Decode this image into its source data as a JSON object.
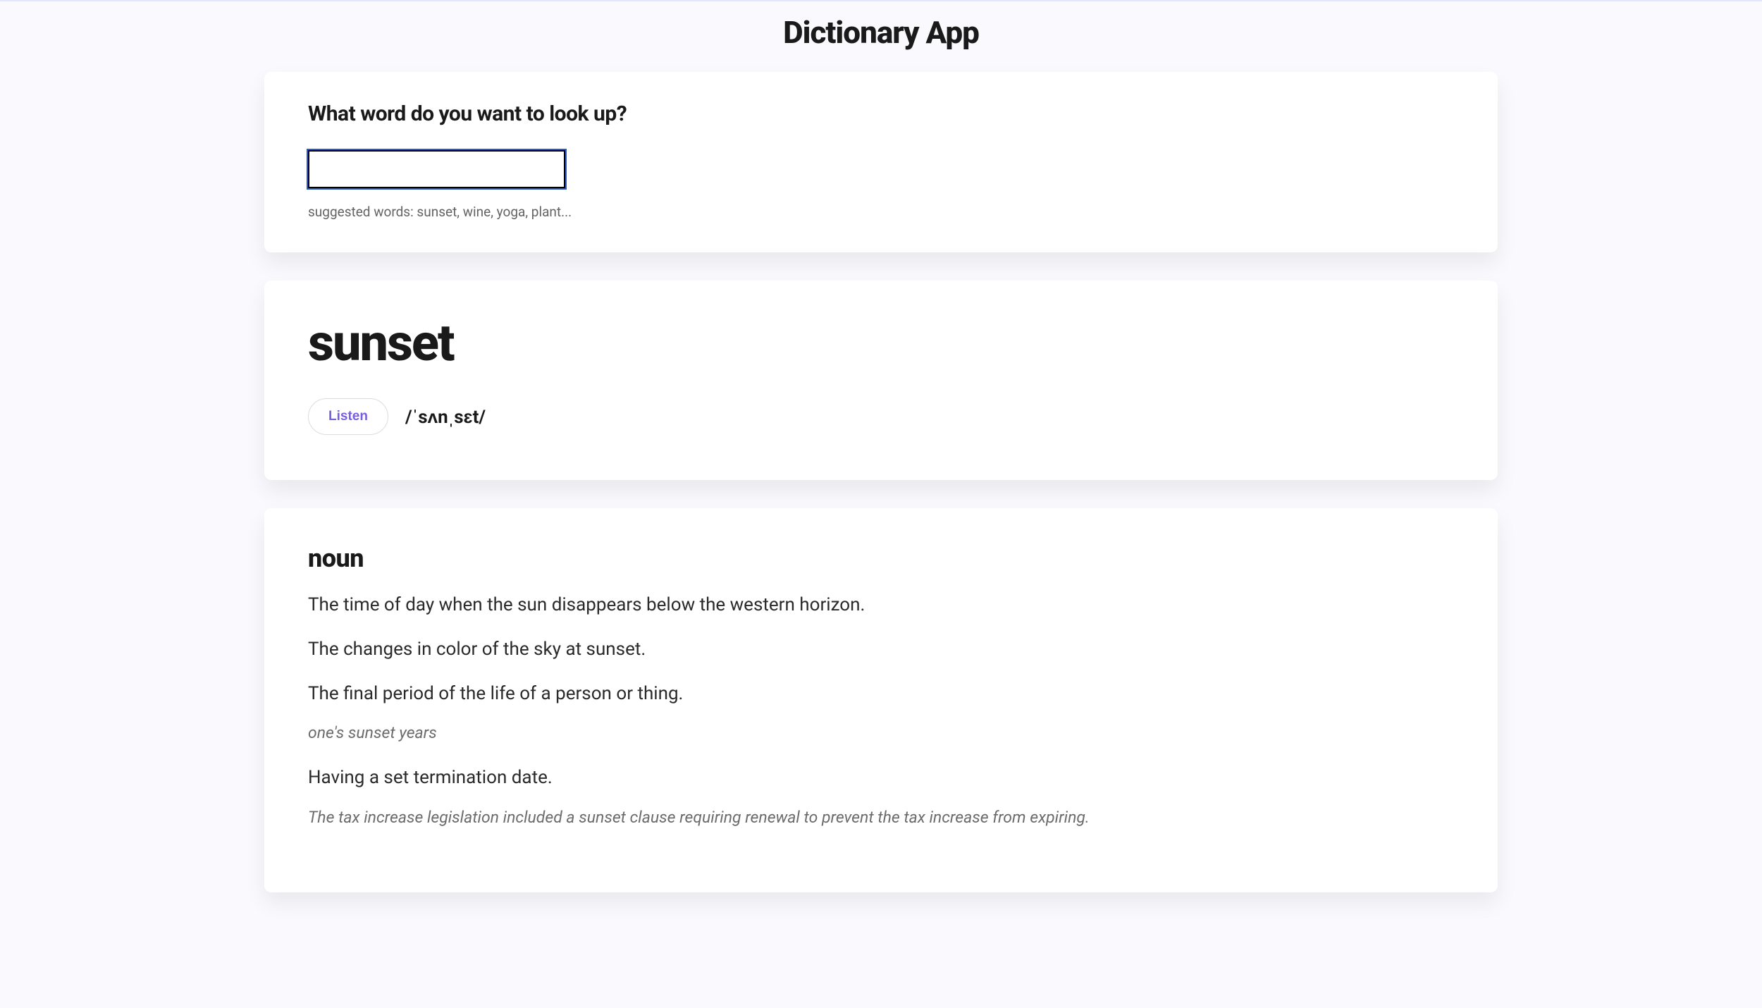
{
  "app": {
    "title": "Dictionary App"
  },
  "search": {
    "prompt": "What word do you want to look up?",
    "value": "",
    "placeholder": "",
    "suggested_line": "suggested words: sunset, wine, yoga, plant..."
  },
  "entry": {
    "word": "sunset",
    "listen_label": "Listen",
    "phonetic": "/ˈsʌnˌsɛt/"
  },
  "definitions": {
    "part_of_speech": "noun",
    "list": [
      {
        "definition": "The time of day when the sun disappears below the western horizon.",
        "example": ""
      },
      {
        "definition": "The changes in color of the sky at sunset.",
        "example": ""
      },
      {
        "definition": "The final period of the life of a person or thing.",
        "example": "one's sunset years"
      },
      {
        "definition": "Having a set termination date.",
        "example": "The tax increase legislation included a sunset clause requiring renewal to prevent the tax increase from expiring."
      }
    ]
  }
}
